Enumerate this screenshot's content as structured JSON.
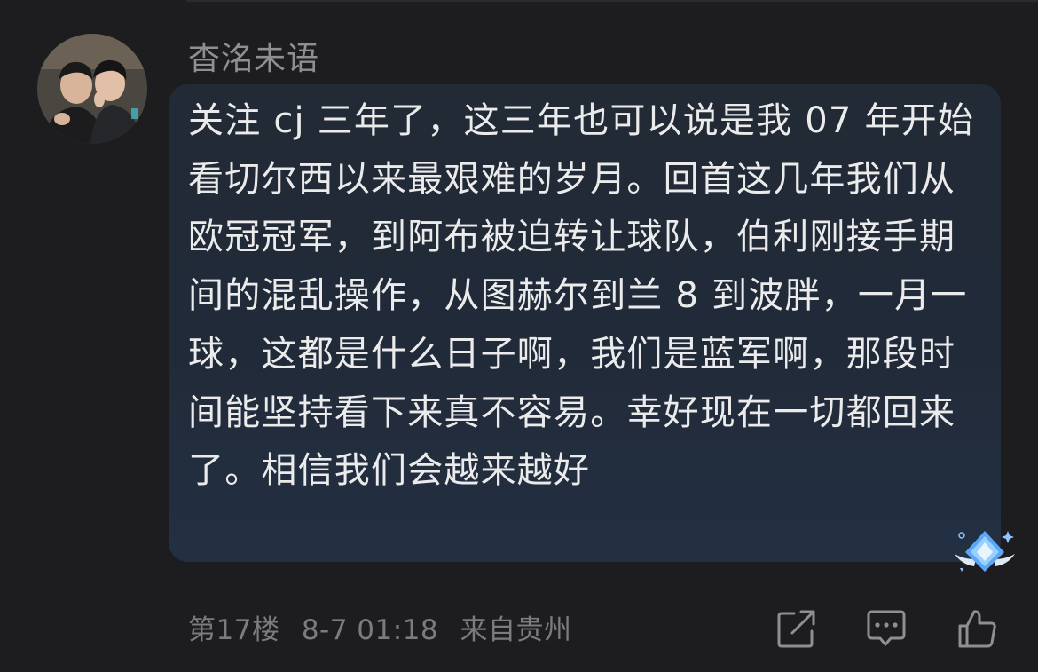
{
  "post": {
    "username": "杳洺未语",
    "content": "关注 cj 三年了，这三年也可以说是我 07 年开始看切尔西以来最艰难的岁月。回首这几年我们从欧冠冠军，到阿布被迫转让球队，伯利刚接手期间的混乱操作，从图赫尔到兰 8 到波胖，一月一球，这都是什么日子啊，我们是蓝军啊，那段时间能坚持看下来真不容易。幸好现在一切都回来了。相信我们会越来越好",
    "floor": "第17楼",
    "date": "8-7 01:18",
    "location": "来自贵州"
  },
  "icons": {
    "share": "share-icon",
    "comment": "comment-icon",
    "like": "thumbs-up-icon",
    "badge": "diamond-badge-icon"
  },
  "colors": {
    "background": "#1d1d1f",
    "bubble": "#222a36",
    "text": "#ebebeb",
    "muted": "#8e8e93",
    "badge_accent": "#6fb4ff"
  }
}
